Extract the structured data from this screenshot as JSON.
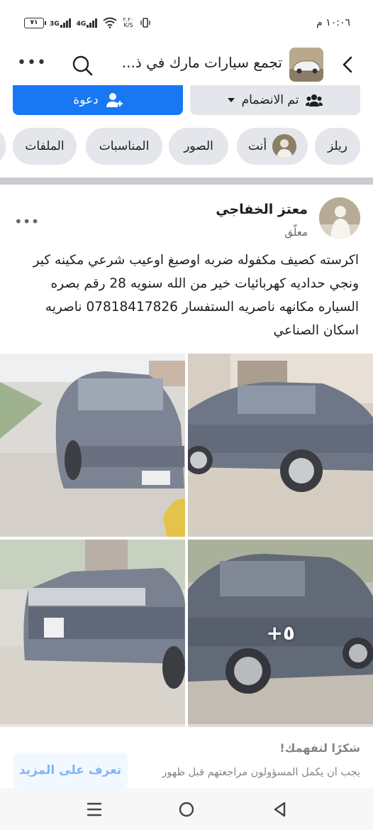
{
  "status_bar": {
    "battery": "٧١",
    "network_1": "3G",
    "network_2": "4G",
    "speed_value": "٢.٢٠",
    "speed_unit": "K/S",
    "time": "١٠:٠٦ م"
  },
  "header": {
    "group_title": "تجمع سيارات مارك في ذ...",
    "back_icon": "chevron-left-icon",
    "search_icon": "search-icon",
    "more_icon": "more-horizontal-icon",
    "more_label": "•••"
  },
  "actions": {
    "joined_label": "تم الانضمام",
    "invite_label": "دعوة"
  },
  "tabs": [
    {
      "label": "ريلز"
    },
    {
      "label": "أنت"
    },
    {
      "label": "الصور"
    },
    {
      "label": "المناسبات"
    },
    {
      "label": "الملفات"
    }
  ],
  "post": {
    "author": "معتز الخفاجي",
    "meta": "معلّق",
    "more_label": "•••",
    "text": "اكرسته كصيف مكفوله ضربه اوصبغ اوعيب شرعي مكينه كير ونجي حداديه كهربائيات خير من الله سنويه 28 رقم بصره السياره مكانهه ناصريه الستفسار 07818417826 ناصريه اسكان الصناعي",
    "extra_photos": "+٥"
  },
  "notice": {
    "title": "شكرًا لتفهمك!",
    "body": "يجب أن يكمل المسؤولون مراجعتهم قبل ظهور",
    "button": "تعرف على المزيد"
  },
  "colors": {
    "accent": "#1877f2",
    "chip_bg": "#e4e6eb",
    "secondary_text": "#65676b"
  }
}
